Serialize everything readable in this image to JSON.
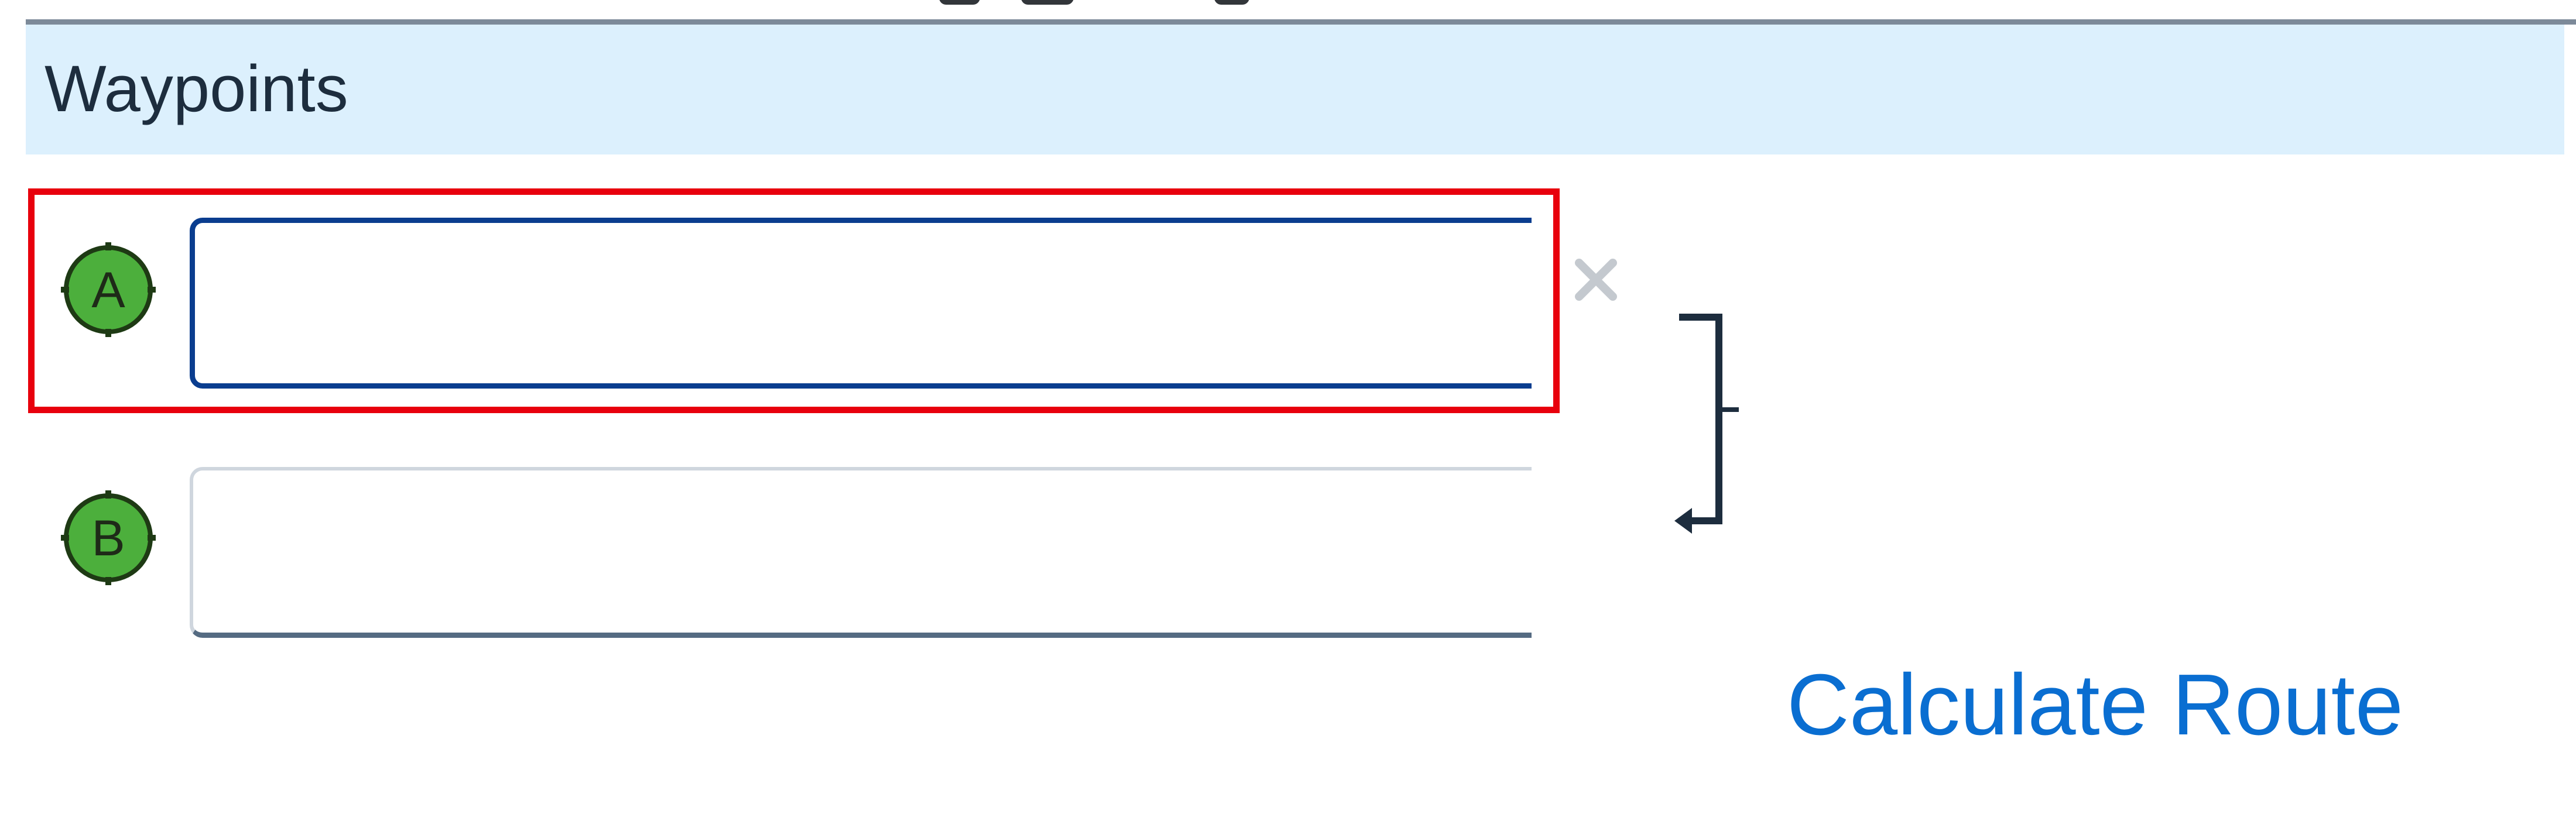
{
  "section": {
    "title": "Waypoints"
  },
  "waypoints": [
    {
      "marker_letter": "A",
      "value": "",
      "placeholder": "",
      "state": "focused"
    },
    {
      "marker_letter": "B",
      "value": "",
      "placeholder": "",
      "state": "idle"
    }
  ],
  "icons": {
    "clear": "close-icon",
    "swap": "swap-waypoints-icon",
    "marker": "map-pin-icon"
  },
  "actions": {
    "calculate_route_label": "Calculate Route"
  },
  "colors": {
    "header_bg": "#dcf0fd",
    "marker_fill": "#4caf3c",
    "focus_border": "#0a3d8f",
    "highlight": "#e8000d",
    "link": "#0a6ed1"
  }
}
